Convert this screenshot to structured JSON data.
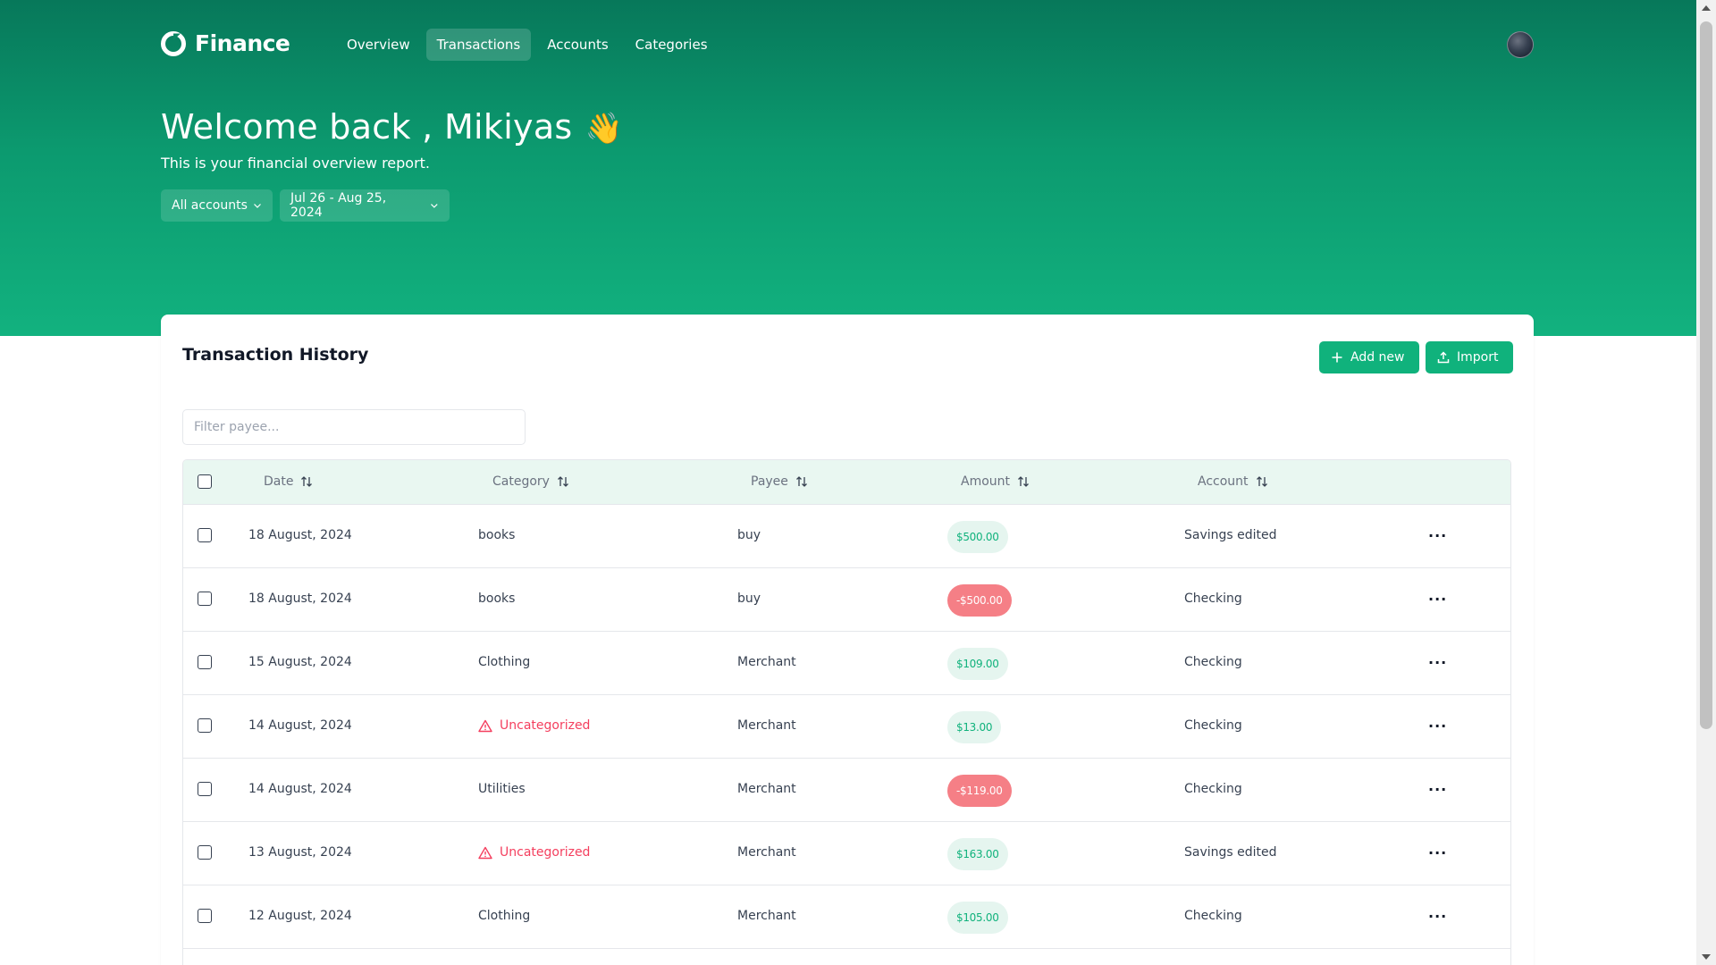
{
  "brand": {
    "name": "Finance"
  },
  "nav": {
    "items": [
      {
        "label": "Overview",
        "active": false
      },
      {
        "label": "Transactions",
        "active": true
      },
      {
        "label": "Accounts",
        "active": false
      },
      {
        "label": "Categories",
        "active": false
      }
    ]
  },
  "hero": {
    "welcome": "Welcome back , Mikiyas",
    "wave": "👋",
    "subtitle": "This is your financial overview report.",
    "account_filter": "All accounts",
    "date_filter": "Jul 26 - Aug 25, 2024"
  },
  "card": {
    "title": "Transaction History",
    "add_label": "Add new",
    "import_label": "Import",
    "filter_placeholder": "Filter payee..."
  },
  "table": {
    "headers": {
      "date": "Date",
      "category": "Category",
      "payee": "Payee",
      "amount": "Amount",
      "account": "Account"
    },
    "rows": [
      {
        "date": "18 August, 2024",
        "category": "books",
        "uncategorized": false,
        "payee": "buy",
        "amount": "$500.00",
        "negative": false,
        "account": "Savings edited"
      },
      {
        "date": "18 August, 2024",
        "category": "books",
        "uncategorized": false,
        "payee": "buy",
        "amount": "-$500.00",
        "negative": true,
        "account": "Checking"
      },
      {
        "date": "15 August, 2024",
        "category": "Clothing",
        "uncategorized": false,
        "payee": "Merchant",
        "amount": "$109.00",
        "negative": false,
        "account": "Checking"
      },
      {
        "date": "14 August, 2024",
        "category": "Uncategorized",
        "uncategorized": true,
        "payee": "Merchant",
        "amount": "$13.00",
        "negative": false,
        "account": "Checking"
      },
      {
        "date": "14 August, 2024",
        "category": "Utilities",
        "uncategorized": false,
        "payee": "Merchant",
        "amount": "-$119.00",
        "negative": true,
        "account": "Checking"
      },
      {
        "date": "13 August, 2024",
        "category": "Uncategorized",
        "uncategorized": true,
        "payee": "Merchant",
        "amount": "$163.00",
        "negative": false,
        "account": "Savings edited"
      },
      {
        "date": "12 August, 2024",
        "category": "Clothing",
        "uncategorized": false,
        "payee": "Merchant",
        "amount": "$105.00",
        "negative": false,
        "account": "Checking"
      },
      {
        "date": "",
        "category": "",
        "uncategorized": false,
        "payee": "",
        "amount": "",
        "negative": true,
        "account": ""
      }
    ]
  },
  "colors": {
    "brand_green": "#10b27c",
    "hero_top": "#07785a",
    "hero_bottom": "#12b27f",
    "negative_pill": "#f57f86",
    "uncategorized": "#f43f5e"
  }
}
